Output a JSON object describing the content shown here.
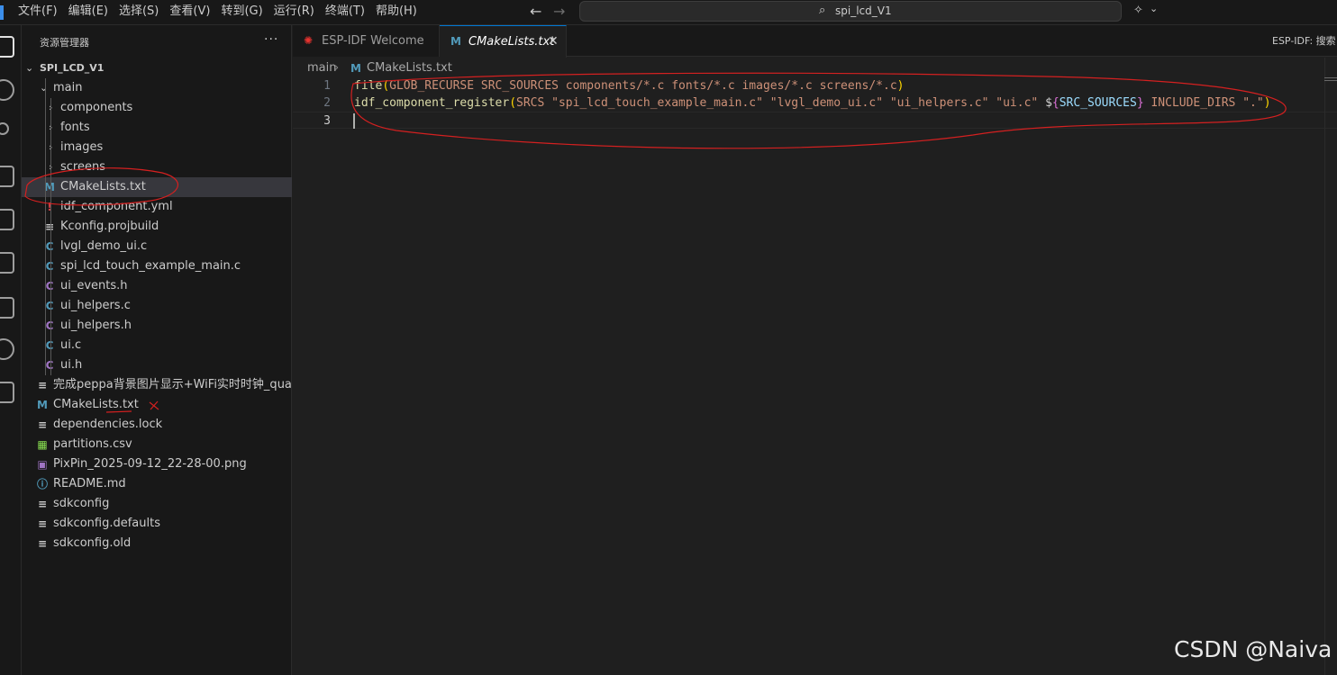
{
  "menu": [
    "文件(F)",
    "编辑(E)",
    "选择(S)",
    "查看(V)",
    "转到(G)",
    "运行(R)",
    "终端(T)",
    "帮助(H)"
  ],
  "title": {
    "back": "←",
    "forward": "→",
    "search_glyph": "⌕",
    "command_center": "spi_lcd_V1",
    "copilot_glyph": "✧",
    "chevron": "⌄"
  },
  "activity_icons": [
    "explorer-icon",
    "search-icon",
    "source-control-icon",
    "run-debug-icon",
    "extensions-icon",
    "testing-icon",
    "remote-explorer-icon",
    "esp-idf-icon",
    "docker-icon"
  ],
  "sidebar": {
    "title": "资源管理器",
    "more": "···",
    "root": "SPI_LCD_V1",
    "folder_main": "main",
    "subfolders": [
      "components",
      "fonts",
      "images",
      "screens"
    ],
    "main_files": [
      {
        "icon": "M",
        "name": "CMakeLists.txt",
        "color": "#519aba"
      },
      {
        "icon": "!",
        "name": "idf_component.yml",
        "color": "#cc3e44"
      },
      {
        "icon": "≡",
        "name": "Kconfig.projbuild",
        "color": "#cccccc"
      },
      {
        "icon": "C",
        "name": "lvgl_demo_ui.c",
        "color": "#519aba"
      },
      {
        "icon": "C",
        "name": "spi_lcd_touch_example_main.c",
        "color": "#519aba"
      },
      {
        "icon": "C",
        "name": "ui_events.h",
        "color": "#a074c4"
      },
      {
        "icon": "C",
        "name": "ui_helpers.c",
        "color": "#519aba"
      },
      {
        "icon": "C",
        "name": "ui_helpers.h",
        "color": "#a074c4"
      },
      {
        "icon": "C",
        "name": "ui.c",
        "color": "#519aba"
      },
      {
        "icon": "C",
        "name": "ui.h",
        "color": "#a074c4"
      }
    ],
    "root_files": [
      {
        "icon": "≡",
        "name": "完成peppa背景图片显示+WiFi实时时钟_qua...",
        "color": "#cccccc"
      },
      {
        "icon": "M",
        "name": "CMakeLists.txt",
        "color": "#519aba"
      },
      {
        "icon": "≡",
        "name": "dependencies.lock",
        "color": "#cccccc"
      },
      {
        "icon": "▦",
        "name": "partitions.csv",
        "color": "#89e051"
      },
      {
        "icon": "▣",
        "name": "PixPin_2025-09-12_22-28-00.png",
        "color": "#a074c4"
      },
      {
        "icon": "ⓘ",
        "name": "README.md",
        "color": "#519aba"
      },
      {
        "icon": "≡",
        "name": "sdkconfig",
        "color": "#cccccc"
      },
      {
        "icon": "≡",
        "name": "sdkconfig.defaults",
        "color": "#cccccc"
      },
      {
        "icon": "≡",
        "name": "sdkconfig.old",
        "color": "#cccccc"
      }
    ]
  },
  "tabs": [
    {
      "icon": "✺",
      "label": "ESP-IDF Welcome",
      "active": false,
      "color": "#e7332f"
    },
    {
      "icon": "M",
      "label": "CMakeLists.txt",
      "active": true,
      "close": "✕",
      "color": "#519aba"
    }
  ],
  "editor_actions": "ESP-IDF:  搜索",
  "breadcrumb": {
    "folder": "main",
    "sep": "›",
    "icon": "M",
    "file": "CMakeLists.txt"
  },
  "code_lines": [
    {
      "no": "1",
      "tokens": [
        {
          "t": "file",
          "c": "tok-fn"
        },
        {
          "t": "(",
          "c": "tok-paren"
        },
        {
          "t": "GLOB_RECURSE SRC_SOURCES components/*.c fonts/*.c images/*.c screens/*.c",
          "c": "tok-text"
        },
        {
          "t": ")",
          "c": "tok-paren"
        }
      ]
    },
    {
      "no": "2",
      "tokens": [
        {
          "t": "idf_component_register",
          "c": "tok-fn"
        },
        {
          "t": "(",
          "c": "tok-paren"
        },
        {
          "t": "SRCS ",
          "c": "tok-text"
        },
        {
          "t": "\"spi_lcd_touch_example_main.c\"",
          "c": "tok-text"
        },
        {
          "t": " ",
          "c": "tok-sp"
        },
        {
          "t": "\"lvgl_demo_ui.c\"",
          "c": "tok-text"
        },
        {
          "t": " ",
          "c": "tok-sp"
        },
        {
          "t": "\"ui_helpers.c\"",
          "c": "tok-text"
        },
        {
          "t": " ",
          "c": "tok-sp"
        },
        {
          "t": "\"ui.c\"",
          "c": "tok-text"
        },
        {
          "t": " ",
          "c": "tok-sp"
        },
        {
          "t": "$",
          "c": "tok-sp"
        },
        {
          "t": "{",
          "c": "tok-brace"
        },
        {
          "t": "SRC_SOURCES",
          "c": "tok-var"
        },
        {
          "t": "}",
          "c": "tok-brace"
        },
        {
          "t": " INCLUDE_DIRS ",
          "c": "tok-text"
        },
        {
          "t": "\".\"",
          "c": "tok-text"
        },
        {
          "t": ")",
          "c": "tok-paren"
        }
      ]
    },
    {
      "no": "3",
      "tokens": []
    }
  ],
  "watermark": "CSDN @Naiva",
  "colors": {
    "accent": "#0078d4",
    "annotation": "#d42020",
    "selection": "#37373d"
  }
}
